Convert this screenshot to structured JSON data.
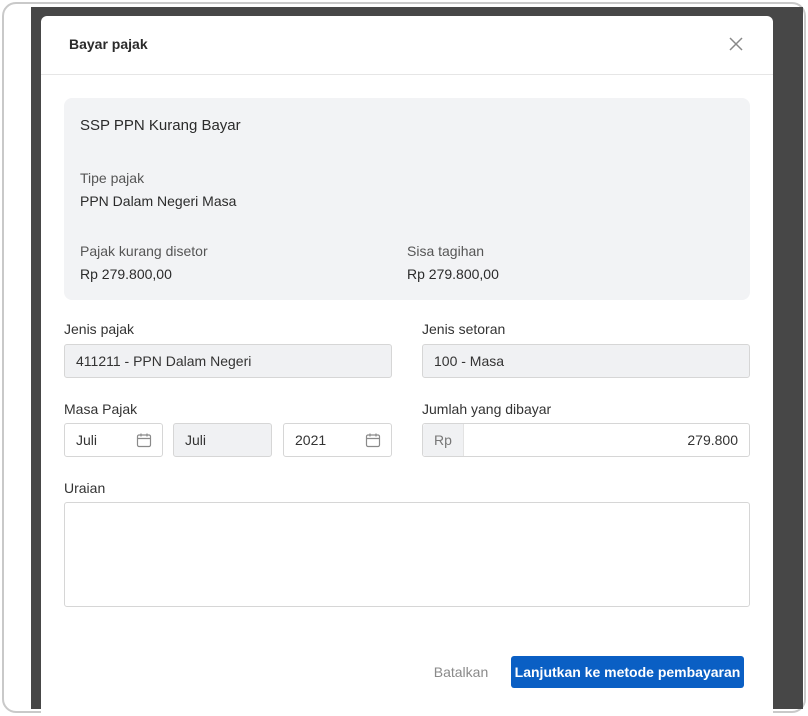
{
  "modal": {
    "title": "Bayar pajak",
    "close_icon": "close-icon"
  },
  "summary": {
    "title": "SSP PPN Kurang Bayar",
    "tipe_label": "Tipe pajak",
    "tipe_value": "PPN Dalam Negeri Masa",
    "kurang_label": "Pajak kurang disetor",
    "kurang_value": "Rp 279.800,00",
    "sisa_label": "Sisa tagihan",
    "sisa_value": "Rp 279.800,00"
  },
  "form": {
    "jenis_pajak_label": "Jenis pajak",
    "jenis_pajak_value": "411211 - PPN Dalam Negeri",
    "jenis_setoran_label": "Jenis setoran",
    "jenis_setoran_value": "100 - Masa",
    "masa_label": "Masa Pajak",
    "masa_from": "Juli",
    "masa_to": "Juli",
    "masa_year": "2021",
    "calendar_icon": "calendar-icon",
    "jumlah_label": "Jumlah yang dibayar",
    "currency_prefix": "Rp",
    "jumlah_value": "279.800",
    "uraian_label": "Uraian",
    "uraian_value": ""
  },
  "footer": {
    "cancel_label": "Batalkan",
    "submit_label": "Lanjutkan ke metode pembayaran"
  },
  "colors": {
    "primary": "#0a5fc4",
    "summary_bg": "#f2f3f5",
    "backdrop": "#474747"
  }
}
